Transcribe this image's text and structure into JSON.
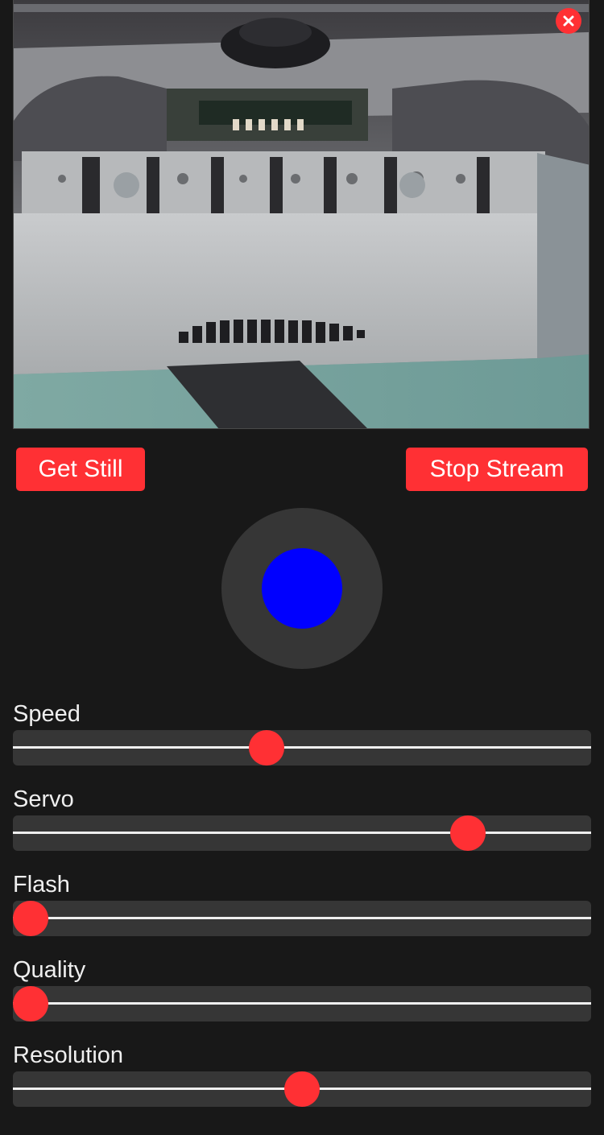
{
  "stream": {
    "close_icon": "close-icon"
  },
  "buttons": {
    "get_still": "Get Still",
    "stop_stream": "Stop Stream"
  },
  "joystick": {
    "x": 0,
    "y": 0
  },
  "sliders": [
    {
      "id": "speed",
      "label": "Speed",
      "fraction": 0.435
    },
    {
      "id": "servo",
      "label": "Servo",
      "fraction": 0.805
    },
    {
      "id": "flash",
      "label": "Flash",
      "fraction": 0.0
    },
    {
      "id": "quality",
      "label": "Quality",
      "fraction": 0.0
    },
    {
      "id": "resolution",
      "label": "Resolution",
      "fraction": 0.5
    }
  ],
  "colors": {
    "accent": "#ff3034",
    "knob": "#0000ff",
    "background": "#181818",
    "track": "#363636"
  }
}
